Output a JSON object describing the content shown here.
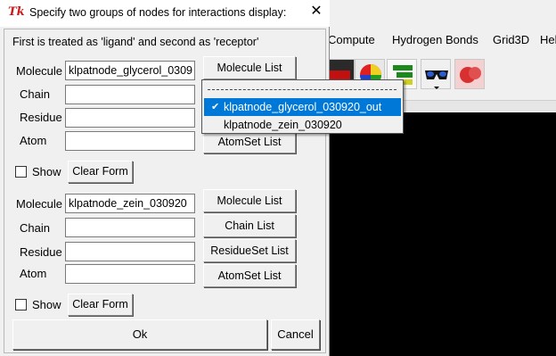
{
  "dialog": {
    "title": "Specify two groups of nodes for interactions display:",
    "tk_logo": "Tk",
    "close_glyph": "✕",
    "hint": "First is treated as 'ligand' and second as 'receptor'"
  },
  "group1": {
    "molecule_label": "Molecule",
    "molecule_value": "klpatnode_glycerol_0309",
    "chain_label": "Chain",
    "chain_value": "",
    "residue_label": "Residue",
    "residue_value": "",
    "atom_label": "Atom",
    "atom_value": "",
    "molecule_list_button": "Molecule List",
    "atomset_list_button": "AtomSet List",
    "show_label": "Show",
    "clear_form_button": "Clear Form"
  },
  "group2": {
    "molecule_label": "Molecule",
    "molecule_value": "klpatnode_zein_030920",
    "chain_label": "Chain",
    "chain_value": "",
    "residue_label": "Residue",
    "residue_value": "",
    "atom_label": "Atom",
    "atom_value": "",
    "molecule_list_button": "Molecule List",
    "chain_list_button": "Chain List",
    "residueset_list_button": "ResidueSet List",
    "atomset_list_button": "AtomSet List",
    "show_label": "Show",
    "clear_form_button": "Clear Form"
  },
  "footer": {
    "ok_button": "Ok",
    "cancel_button": "Cancel"
  },
  "dropdown": {
    "items": [
      {
        "label": "klpatnode_glycerol_030920_out",
        "selected": true
      },
      {
        "label": "klpatnode_zein_030920",
        "selected": false
      }
    ],
    "check_glyph": "✔"
  },
  "background_app": {
    "menus": [
      "Compute",
      "Hydrogen Bonds",
      "Grid3D",
      "Hel"
    ],
    "toolbar_icons": [
      "molecule-render-icon",
      "color-wheel-icon",
      "hierarchy-icon",
      "stereo-glasses-icon",
      "surface-icon"
    ]
  }
}
